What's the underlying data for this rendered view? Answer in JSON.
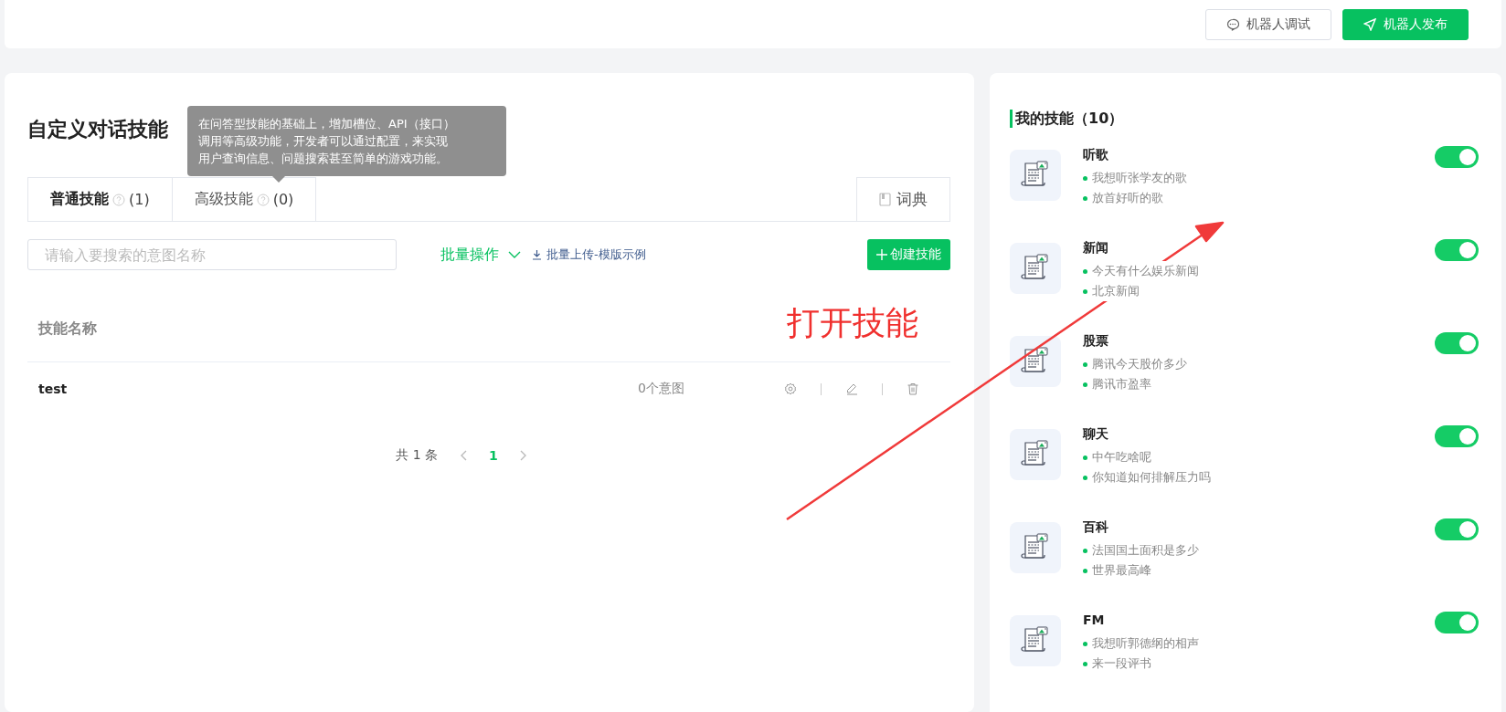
{
  "toolbar": {
    "buttons": [
      {
        "label": "机器人调试",
        "kind": "outline"
      },
      {
        "label": "机器人发布",
        "kind": "primary"
      }
    ]
  },
  "custom_skills": {
    "title": "自定义对话技能",
    "tooltip": [
      "在问答型技能的基础上，增加槽位、API（接口）",
      "调用等高级功能，开发者可以通过配置，来实现",
      "用户查询信息、问题搜索甚至简单的游戏功能。"
    ],
    "tabs": [
      {
        "label": "普通技能",
        "count": "(1)",
        "selected": true
      },
      {
        "label": "高级技能",
        "count": "(0)",
        "selected": false
      }
    ],
    "dictionary_tab": "词典",
    "search": {
      "placeholder": "请输入要搜索的意图名称"
    },
    "batch_menu": "批量操作",
    "template_link": "批量上传-模版示例",
    "create_button": "创建技能",
    "table": {
      "columns": [
        "技能名称"
      ],
      "rows": [
        {
          "name": "test",
          "intents": "0个意图"
        }
      ]
    },
    "pagination": {
      "total": "共 1 条",
      "pages": [
        {
          "label": "1",
          "selected": true
        }
      ]
    }
  },
  "annotation": {
    "text": "打开技能"
  },
  "my_skills": {
    "title": "我的技能（10）",
    "items": [
      {
        "name": "听歌",
        "examples": [
          "我想听张学友的歌",
          "放首好听的歌"
        ],
        "on": true
      },
      {
        "name": "新闻",
        "examples": [
          "今天有什么娱乐新闻",
          "北京新闻"
        ],
        "on": true
      },
      {
        "name": "股票",
        "examples": [
          "腾讯今天股价多少",
          "腾讯市盈率"
        ],
        "on": true
      },
      {
        "name": "聊天",
        "examples": [
          "中午吃啥呢",
          "你知道如何排解压力吗"
        ],
        "on": true
      },
      {
        "name": "百科",
        "examples": [
          "法国国土面积是多少",
          "世界最高峰"
        ],
        "on": true
      },
      {
        "name": "FM",
        "examples": [
          "我想听郭德纲的相声",
          "来一段评书"
        ],
        "on": true
      }
    ]
  }
}
